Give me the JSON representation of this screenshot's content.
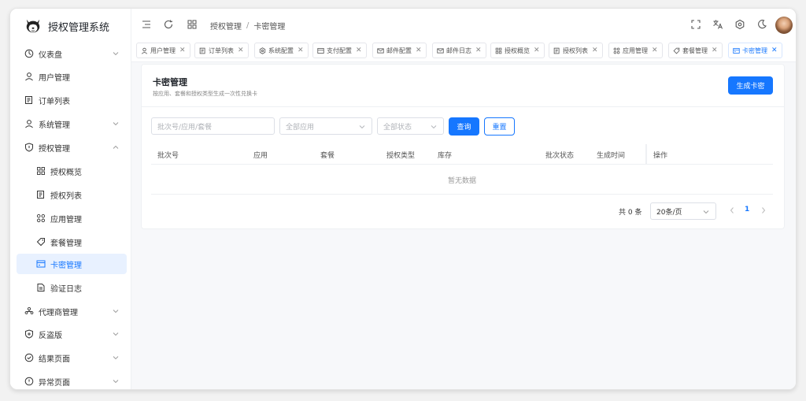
{
  "app": {
    "title": "授权管理系统"
  },
  "sidebar": {
    "items": [
      {
        "label": "仪表盘",
        "icon": "dashboard-icon",
        "expandable": true,
        "expanded": false
      },
      {
        "label": "用户管理",
        "icon": "user-icon",
        "expandable": false
      },
      {
        "label": "订单列表",
        "icon": "order-list-icon",
        "expandable": false
      },
      {
        "label": "系统管理",
        "icon": "user-icon",
        "expandable": true,
        "expanded": false
      },
      {
        "label": "授权管理",
        "icon": "shield-icon",
        "expandable": true,
        "expanded": true
      },
      {
        "label": "授权概览",
        "icon": "grid-icon",
        "sub": true
      },
      {
        "label": "授权列表",
        "icon": "order-list-icon",
        "sub": true
      },
      {
        "label": "应用管理",
        "icon": "apps-icon",
        "sub": true
      },
      {
        "label": "套餐管理",
        "icon": "tag-icon",
        "sub": true
      },
      {
        "label": "卡密管理",
        "icon": "card-icon",
        "sub": true,
        "active": true
      },
      {
        "label": "验证日志",
        "icon": "log-icon",
        "sub": true
      },
      {
        "label": "代理商管理",
        "icon": "agent-icon",
        "expandable": true,
        "expanded": false
      },
      {
        "label": "反盗版",
        "icon": "shield-plus-icon",
        "expandable": true,
        "expanded": false
      },
      {
        "label": "结果页面",
        "icon": "check-circle-icon",
        "expandable": true,
        "expanded": false
      },
      {
        "label": "异常页面",
        "icon": "warning-circle-icon",
        "expandable": true,
        "expanded": false
      }
    ]
  },
  "topbar": {
    "breadcrumb": [
      "授权管理",
      "卡密管理"
    ],
    "icons": [
      "menu-fold-icon",
      "refresh-icon",
      "grid-icon",
      "fullscreen-icon",
      "translate-icon",
      "settings-icon",
      "dark-mode-icon"
    ]
  },
  "tabs": [
    {
      "label": "用户管理",
      "icon": "user-icon"
    },
    {
      "label": "订单列表",
      "icon": "order-list-icon"
    },
    {
      "label": "系统配置",
      "icon": "settings-icon"
    },
    {
      "label": "支付配置",
      "icon": "payment-icon"
    },
    {
      "label": "邮件配置",
      "icon": "mail-icon"
    },
    {
      "label": "邮件日志",
      "icon": "mail-icon"
    },
    {
      "label": "授权概览",
      "icon": "grid-icon"
    },
    {
      "label": "授权列表",
      "icon": "order-list-icon"
    },
    {
      "label": "应用管理",
      "icon": "apps-icon"
    },
    {
      "label": "套餐管理",
      "icon": "tag-icon"
    },
    {
      "label": "卡密管理",
      "icon": "card-icon",
      "active": true
    }
  ],
  "page": {
    "title": "卡密管理",
    "subtitle": "按应用、套餐和授权类型生成一次性兑换卡",
    "generate_button": "生成卡密"
  },
  "filters": {
    "search_placeholder": "批次号/应用/套餐",
    "app_select": "全部应用",
    "status_select": "全部状态",
    "query_button": "查询",
    "reset_button": "重置"
  },
  "table": {
    "columns": [
      "批次号",
      "应用",
      "套餐",
      "授权类型",
      "库存",
      "批次状态",
      "生成时间",
      "操作"
    ],
    "empty_text": "暂无数据"
  },
  "pagination": {
    "total_text": "共 0 条",
    "page_size": "20条/页",
    "current_page": "1"
  },
  "colors": {
    "primary": "#1677ff",
    "active_bg": "#e8f1ff"
  }
}
